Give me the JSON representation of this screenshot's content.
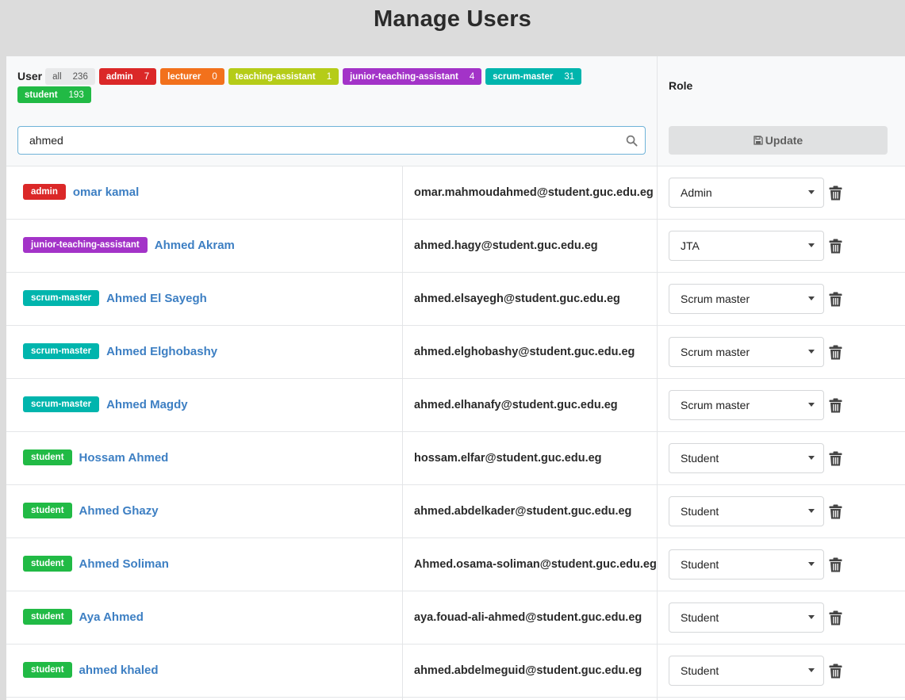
{
  "page": {
    "title": "Manage Users"
  },
  "header": {
    "user_label": "User",
    "role_label": "Role",
    "filters": [
      {
        "label": "all",
        "count": "236",
        "color": "#e8e9ea",
        "variant": "all"
      },
      {
        "label": "admin",
        "count": "7",
        "color": "#db2828"
      },
      {
        "label": "lecturer",
        "count": "0",
        "color": "#f2711c"
      },
      {
        "label": "teaching-assistant",
        "count": "1",
        "color": "#b5cc18"
      },
      {
        "label": "junior-teaching-assistant",
        "count": "4",
        "color": "#a333c8"
      },
      {
        "label": "scrum-master",
        "count": "31",
        "color": "#00b5ad"
      },
      {
        "label": "student",
        "count": "193",
        "color": "#21ba45"
      }
    ]
  },
  "search": {
    "value": "ahmed",
    "icon": "search-icon"
  },
  "update_button": {
    "label": "Update",
    "icon": "save-icon"
  },
  "users": [
    {
      "role_badge": "admin",
      "badge_color": "#db2828",
      "name": "omar kamal",
      "email": "omar.mahmoudahmed@student.guc.edu.eg",
      "role": "Admin"
    },
    {
      "role_badge": "junior-teaching-assistant",
      "badge_color": "#a333c8",
      "name": "Ahmed Akram",
      "email": "ahmed.hagy@student.guc.edu.eg",
      "role": "JTA"
    },
    {
      "role_badge": "scrum-master",
      "badge_color": "#00b5ad",
      "name": "Ahmed El Sayegh",
      "email": "ahmed.elsayegh@student.guc.edu.eg",
      "role": "Scrum master"
    },
    {
      "role_badge": "scrum-master",
      "badge_color": "#00b5ad",
      "name": "Ahmed Elghobashy",
      "email": "ahmed.elghobashy@student.guc.edu.eg",
      "role": "Scrum master"
    },
    {
      "role_badge": "scrum-master",
      "badge_color": "#00b5ad",
      "name": "Ahmed Magdy",
      "email": "ahmed.elhanafy@student.guc.edu.eg",
      "role": "Scrum master"
    },
    {
      "role_badge": "student",
      "badge_color": "#21ba45",
      "name": "Hossam Ahmed",
      "email": "hossam.elfar@student.guc.edu.eg",
      "role": "Student"
    },
    {
      "role_badge": "student",
      "badge_color": "#21ba45",
      "name": "Ahmed Ghazy",
      "email": "ahmed.abdelkader@student.guc.edu.eg",
      "role": "Student"
    },
    {
      "role_badge": "student",
      "badge_color": "#21ba45",
      "name": "Ahmed Soliman",
      "email": "Ahmed.osama-soliman@student.guc.edu.eg",
      "role": "Student"
    },
    {
      "role_badge": "student",
      "badge_color": "#21ba45",
      "name": "Aya Ahmed",
      "email": "aya.fouad-ali-ahmed@student.guc.edu.eg",
      "role": "Student"
    },
    {
      "role_badge": "student",
      "badge_color": "#21ba45",
      "name": "ahmed khaled",
      "email": "ahmed.abdelmeguid@student.guc.edu.eg",
      "role": "Student"
    }
  ]
}
